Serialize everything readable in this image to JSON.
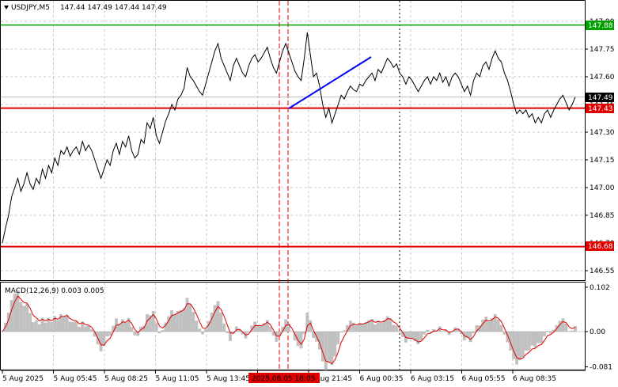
{
  "window": {
    "symbol_label": "USDJPY,M5",
    "ohlc_label": "147.44 147.49 147.44 147.49",
    "collapse_icon": "triangle-down-icon"
  },
  "colors": {
    "price": "#000000",
    "support_resistance": "#e00000",
    "target": "#00a000",
    "trend": "#0000ff",
    "macd_histogram": "#c0c0c0",
    "macd_signal": "#e00000",
    "current_price_tag": "#000000",
    "grid": "#c8c8c8"
  },
  "main_axis": {
    "ticks": [
      "147.90",
      "147.75",
      "147.60",
      "147.45",
      "147.30",
      "147.15",
      "147.00",
      "146.85",
      "146.70",
      "146.55"
    ]
  },
  "levels": {
    "target": {
      "value": 147.88,
      "label": "147.88"
    },
    "resistance": {
      "value": 147.43,
      "label": "147.43"
    },
    "support": {
      "value": 146.68,
      "label": "146.68"
    },
    "current": {
      "value": 147.49,
      "label": "147.49"
    }
  },
  "macd": {
    "label": "MACD(12,26,9) 0.003 0.005",
    "ticks": [
      "0.102",
      "0.00",
      "-0.081"
    ]
  },
  "time_axis": {
    "labels": [
      "5 Aug 2025",
      "5 Aug 05:45",
      "5 Aug 08:25",
      "5 Aug 11:05",
      "5 Aug 13:45",
      "5 Aug 19:05",
      "5 Aug 21:45",
      "6 Aug 00:35",
      "6 Aug 03:15",
      "6 Aug 05:55",
      "6 Aug 08:35"
    ],
    "highlight_label": "2025.08.05 18:05"
  },
  "chart_data": {
    "type": "line",
    "series": [
      {
        "values": [
          146.7,
          146.78,
          146.85,
          146.95,
          147.0,
          147.05,
          146.98,
          147.02,
          147.08,
          147.02,
          146.99,
          147.05,
          147.02,
          147.1,
          147.05,
          147.12,
          147.08,
          147.16,
          147.12,
          147.2,
          147.18,
          147.22,
          147.17,
          147.2,
          147.22,
          147.18,
          147.25,
          147.2,
          147.23,
          147.2,
          147.15,
          147.1,
          147.05,
          147.1,
          147.15,
          147.12,
          147.2,
          147.24,
          147.18,
          147.25,
          147.22,
          147.28,
          147.2,
          147.16,
          147.18,
          147.26,
          147.24,
          147.35,
          147.32,
          147.38,
          147.28,
          147.24,
          147.3,
          147.36,
          147.4,
          147.45,
          147.42,
          147.48,
          147.5,
          147.54,
          147.65,
          147.6,
          147.58,
          147.55,
          147.52,
          147.5,
          147.56,
          147.62,
          147.68,
          147.74,
          147.78,
          147.7,
          147.66,
          147.62,
          147.58,
          147.66,
          147.7,
          147.66,
          147.62,
          147.6,
          147.66,
          147.7,
          147.72,
          147.68,
          147.7,
          147.73,
          147.76,
          147.7,
          147.65,
          147.62,
          147.68,
          147.74,
          147.78,
          147.73,
          147.68,
          147.63,
          147.6,
          147.58,
          147.7,
          147.84,
          147.72,
          147.6,
          147.62,
          147.55,
          147.45,
          147.38,
          147.43,
          147.35,
          147.4,
          147.45,
          147.5,
          147.48,
          147.52,
          147.55,
          147.53,
          147.52,
          147.56,
          147.55,
          147.58,
          147.6,
          147.62,
          147.58,
          147.64,
          147.62,
          147.66,
          147.7,
          147.68,
          147.65,
          147.67,
          147.62,
          147.6,
          147.56,
          147.6,
          147.58,
          147.55,
          147.52,
          147.55,
          147.58,
          147.6,
          147.56,
          147.6,
          147.58,
          147.62,
          147.57,
          147.6,
          147.55,
          147.6,
          147.62,
          147.6,
          147.56,
          147.52,
          147.55,
          147.5,
          147.58,
          147.62,
          147.6,
          147.66,
          147.68,
          147.64,
          147.7,
          147.74,
          147.7,
          147.68,
          147.62,
          147.58,
          147.52,
          147.45,
          147.4,
          147.42,
          147.4,
          147.42,
          147.38,
          147.4,
          147.35,
          147.38,
          147.35,
          147.4,
          147.42,
          147.38,
          147.42,
          147.45,
          147.48,
          147.5,
          147.46,
          147.42,
          147.45,
          147.49
        ]
      }
    ]
  }
}
